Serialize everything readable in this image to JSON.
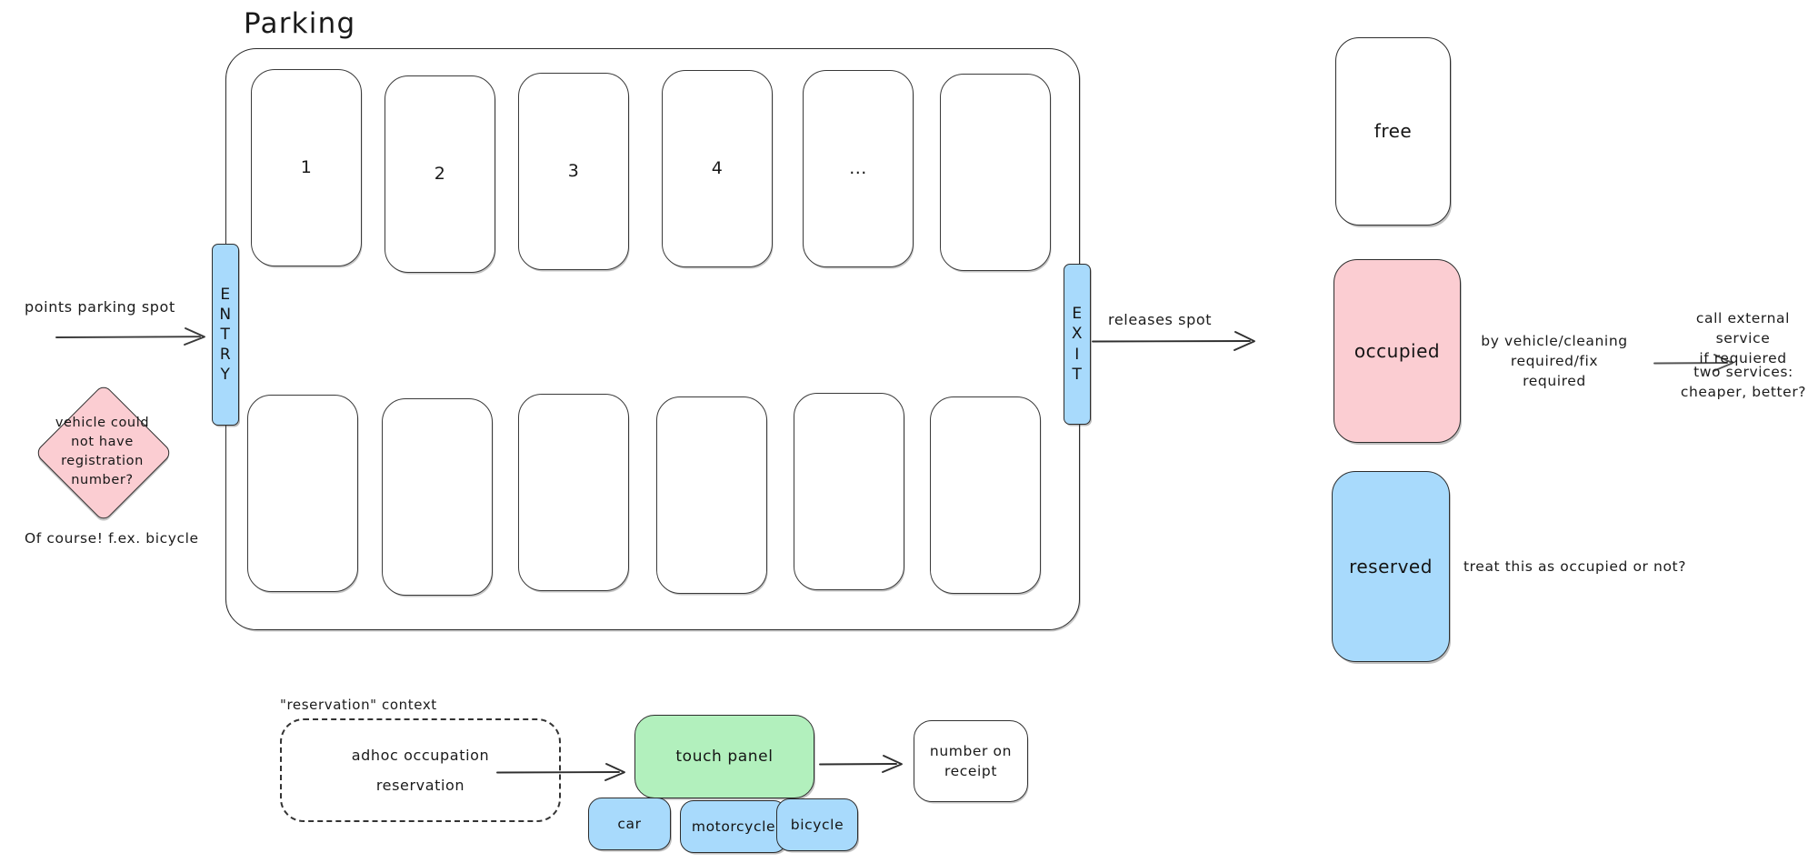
{
  "diagram": {
    "title": "Parking",
    "parking_lot": {
      "top_row_spots": [
        "1",
        "2",
        "3",
        "4",
        "...",
        ""
      ],
      "bottom_row_spots": [
        "",
        "",
        "",
        "",
        "",
        ""
      ],
      "entry_gate": {
        "letters": [
          "E",
          "N",
          "T",
          "R",
          "Y"
        ],
        "name": "ENTRY"
      },
      "exit_gate": {
        "letters": [
          "E",
          "X",
          "I",
          "T"
        ],
        "name": "EXIT"
      }
    },
    "annotations": {
      "entry_arrow_label": "points parking spot",
      "exit_arrow_label": "releases spot",
      "diamond_question": "vehicle could\nnot have\nregistration\nnumber?",
      "diamond_answer": "Of course! f.ex. bicycle"
    },
    "legend": {
      "free": {
        "label": "free",
        "color": "#ffffff"
      },
      "occupied": {
        "label": "occupied",
        "color": "#fbcdd2",
        "note": "by vehicle/cleaning\nrequired/fix\nrequired",
        "service_note": "call external service\nif requiered",
        "service_question": "two services:\ncheaper, better?"
      },
      "reserved": {
        "label": "reserved",
        "color": "#a8dafc",
        "note": "treat this as occupied or not?"
      }
    },
    "reservation_section": {
      "context_label": "\"reservation\" context",
      "box_lines": [
        "adhoc occupation",
        "reservation"
      ],
      "touch_panel": "touch panel",
      "vehicle_types": [
        "car",
        "motorcycle",
        "bicycle"
      ],
      "receipt": "number on\nreceipt"
    }
  }
}
